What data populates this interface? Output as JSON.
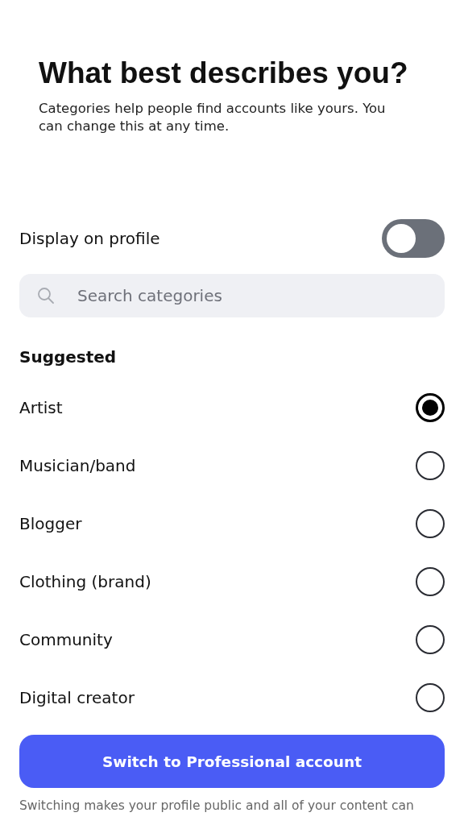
{
  "title": "What best describes you?",
  "subtitle": "Categories help people find accounts like yours. You can change this at any time.",
  "display_on_profile": {
    "label": "Display on profile",
    "on": false
  },
  "search": {
    "placeholder": "Search categories"
  },
  "section_heading": "Suggested",
  "categories": [
    {
      "label": "Artist",
      "selected": true
    },
    {
      "label": "Musician/band",
      "selected": false
    },
    {
      "label": "Blogger",
      "selected": false
    },
    {
      "label": "Clothing (brand)",
      "selected": false
    },
    {
      "label": "Community",
      "selected": false
    },
    {
      "label": "Digital creator",
      "selected": false
    }
  ],
  "primary_button": "Switch to Professional account",
  "footer_note": "Switching makes your profile public and all of your content can"
}
